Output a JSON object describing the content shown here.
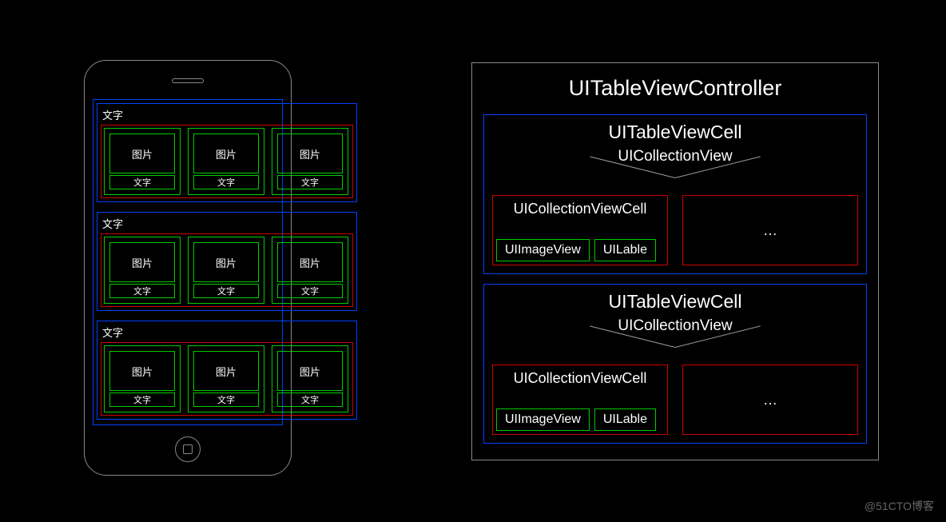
{
  "watermark": "@51CTO博客",
  "phone": {
    "rows": [
      {
        "title": "文字",
        "items": [
          {
            "img": "图片",
            "txt": "文字"
          },
          {
            "img": "图片",
            "txt": "文字"
          },
          {
            "img": "图片",
            "txt": "文字"
          }
        ]
      },
      {
        "title": "文字",
        "items": [
          {
            "img": "图片",
            "txt": "文字"
          },
          {
            "img": "图片",
            "txt": "文字"
          },
          {
            "img": "图片",
            "txt": "文字"
          }
        ]
      },
      {
        "title": "文字",
        "items": [
          {
            "img": "图片",
            "txt": "文字"
          },
          {
            "img": "图片",
            "txt": "文字"
          },
          {
            "img": "图片",
            "txt": "文字"
          }
        ]
      }
    ]
  },
  "hierarchy": {
    "controller": "UITableViewController",
    "cells": [
      {
        "label": "UITableViewCell",
        "collection": "UICollectionView",
        "cvcell": "UICollectionViewCell",
        "image": "UIImageView",
        "textlabel": "UILable",
        "more": "…"
      },
      {
        "label": "UITableViewCell",
        "collection": "UICollectionView",
        "cvcell": "UICollectionViewCell",
        "image": "UIImageView",
        "textlabel": "UILable",
        "more": "…"
      }
    ]
  }
}
